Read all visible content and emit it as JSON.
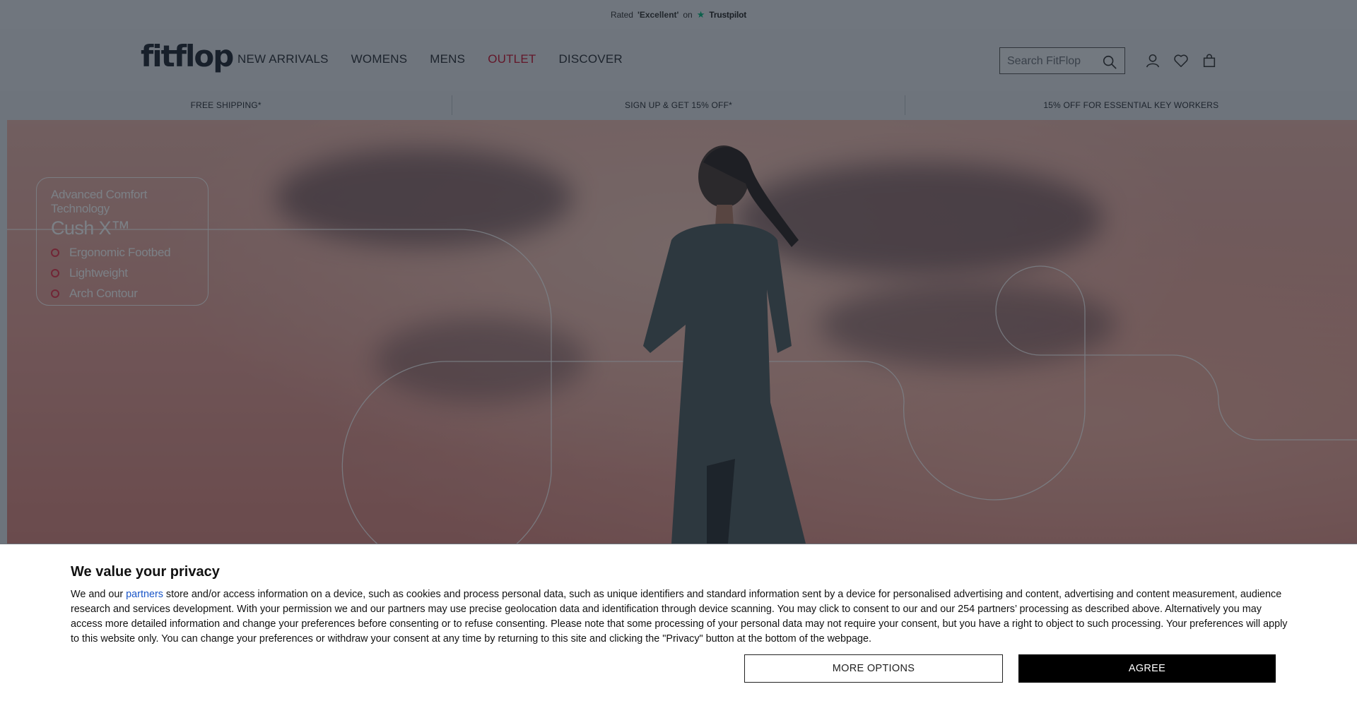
{
  "rating": {
    "prefix": "Rated",
    "score": "'Excellent'",
    "on": "on",
    "brand": "Trustpilot"
  },
  "header": {
    "logo": "fitflop",
    "nav": [
      "NEW ARRIVALS",
      "WOMENS",
      "MENS",
      "OUTLET",
      "DISCOVER"
    ],
    "search_placeholder": "Search FitFlop"
  },
  "promos": [
    "FREE SHIPPING*",
    "SIGN UP & GET 15% OFF*",
    "15% OFF FOR ESSENTIAL KEY WORKERS"
  ],
  "hero": {
    "kicker": "Advanced Comfort Technology",
    "title": "Cush X™",
    "features": [
      "Ergonomic Footbed",
      "Lightweight",
      "Arch Contour"
    ]
  },
  "consent": {
    "title": "We value your privacy",
    "text_before_link": "We and our ",
    "link": "partners",
    "text_after_link": " store and/or access information on a device, such as cookies and process personal data, such as unique identifiers and standard information sent by a device for personalised advertising and content, advertising and content measurement, audience research and services development. With your permission we and our partners may use precise geolocation data and identification through device scanning. You may click to consent to our and our 254 partners’ processing as described above. Alternatively you may access more detailed information and change your preferences before consenting or to refuse consenting. Please note that some processing of your personal data may not require your consent, but you have a right to object to such processing. Your preferences will apply to this website only. You can change your preferences or withdraw your consent at any time by returning to this site and clicking the \"Privacy\" button at the bottom of the webpage.",
    "more_options": "MORE OPTIONS",
    "agree": "AGREE"
  },
  "colors": {
    "outlet": "#c8102e",
    "accent_dot": "#e8344a",
    "trustpilot": "#00b67a"
  }
}
